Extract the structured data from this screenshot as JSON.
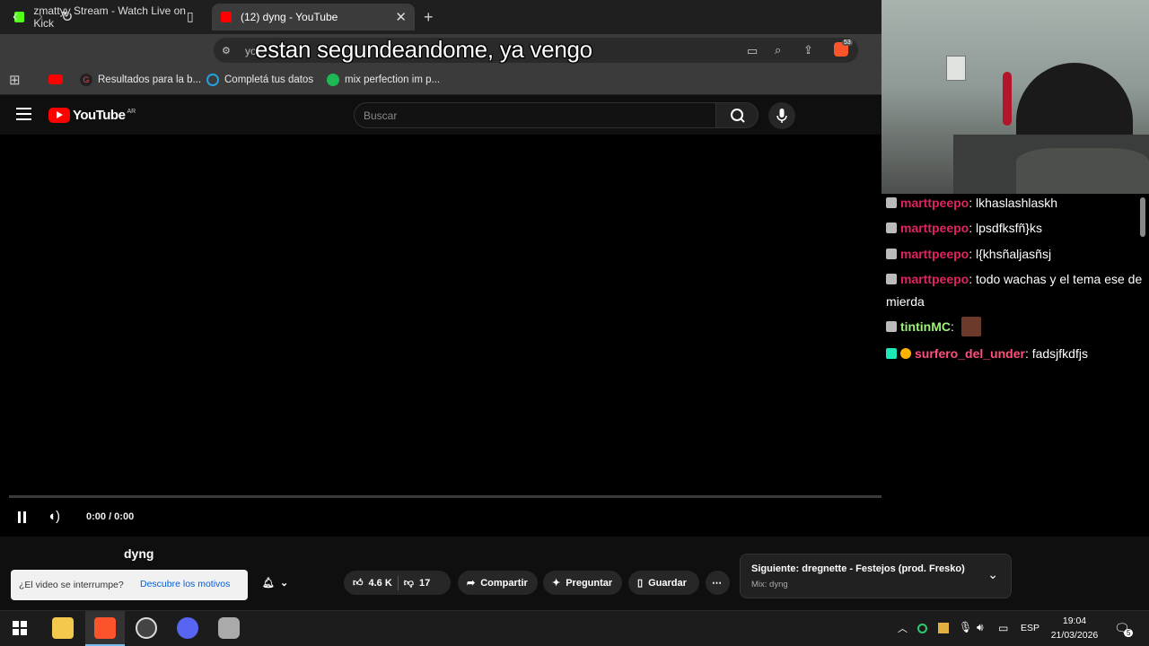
{
  "browser": {
    "tabs": [
      {
        "label": "zmattyy Stream - Watch Live on Kick",
        "active": false
      },
      {
        "label": "(12) dyng - YouTube",
        "active": true
      }
    ],
    "url_visible": "yo",
    "overlay_caption": "estan segundeandome, ya vengo",
    "bookmarks": [
      "Resultados para la b...",
      "Completá tus datos",
      "mix perfection im p..."
    ],
    "brave_badge": "53"
  },
  "youtube": {
    "logo_text": "YouTube",
    "logo_country": "AR",
    "search_placeholder": "Buscar",
    "player_time": "0:00 / 0:00",
    "video_title": "dyng",
    "interrupt_question": "¿El video se interrumpe?",
    "interrupt_link": "Descubre los motivos",
    "likes": "4.6 K",
    "dislikes": "17",
    "share_label": "Compartir",
    "ask_label": "Preguntar",
    "save_label": "Guardar",
    "next_title": "Siguiente: dregnette - Festejos (prod. Fresko)",
    "next_subtitle": "Mix: dyng"
  },
  "chat": {
    "messages": [
      {
        "user": "marttpeepo",
        "text": ": lkhaslashlaskh"
      },
      {
        "user": "marttpeepo",
        "text": ": lpsdfksfñ}ks"
      },
      {
        "user": "marttpeepo",
        "text": ": l{khsñaljasñsj"
      },
      {
        "user": "marttpeepo",
        "text": ": todo wachas y el tema ese de mierda"
      },
      {
        "user": "tintinMC",
        "text": ":"
      },
      {
        "user": "surfero_del_under",
        "text": ": fadsjfkdfjs"
      }
    ]
  },
  "taskbar": {
    "language": "ESP",
    "time": "19:04",
    "date": "21/03/2026",
    "notifications": "5"
  },
  "colors": {
    "youtube_red": "#ff0000",
    "kick_green": "#53fc18",
    "chat_user_red": "#e0245e",
    "chat_user_green": "#9ef27a"
  }
}
